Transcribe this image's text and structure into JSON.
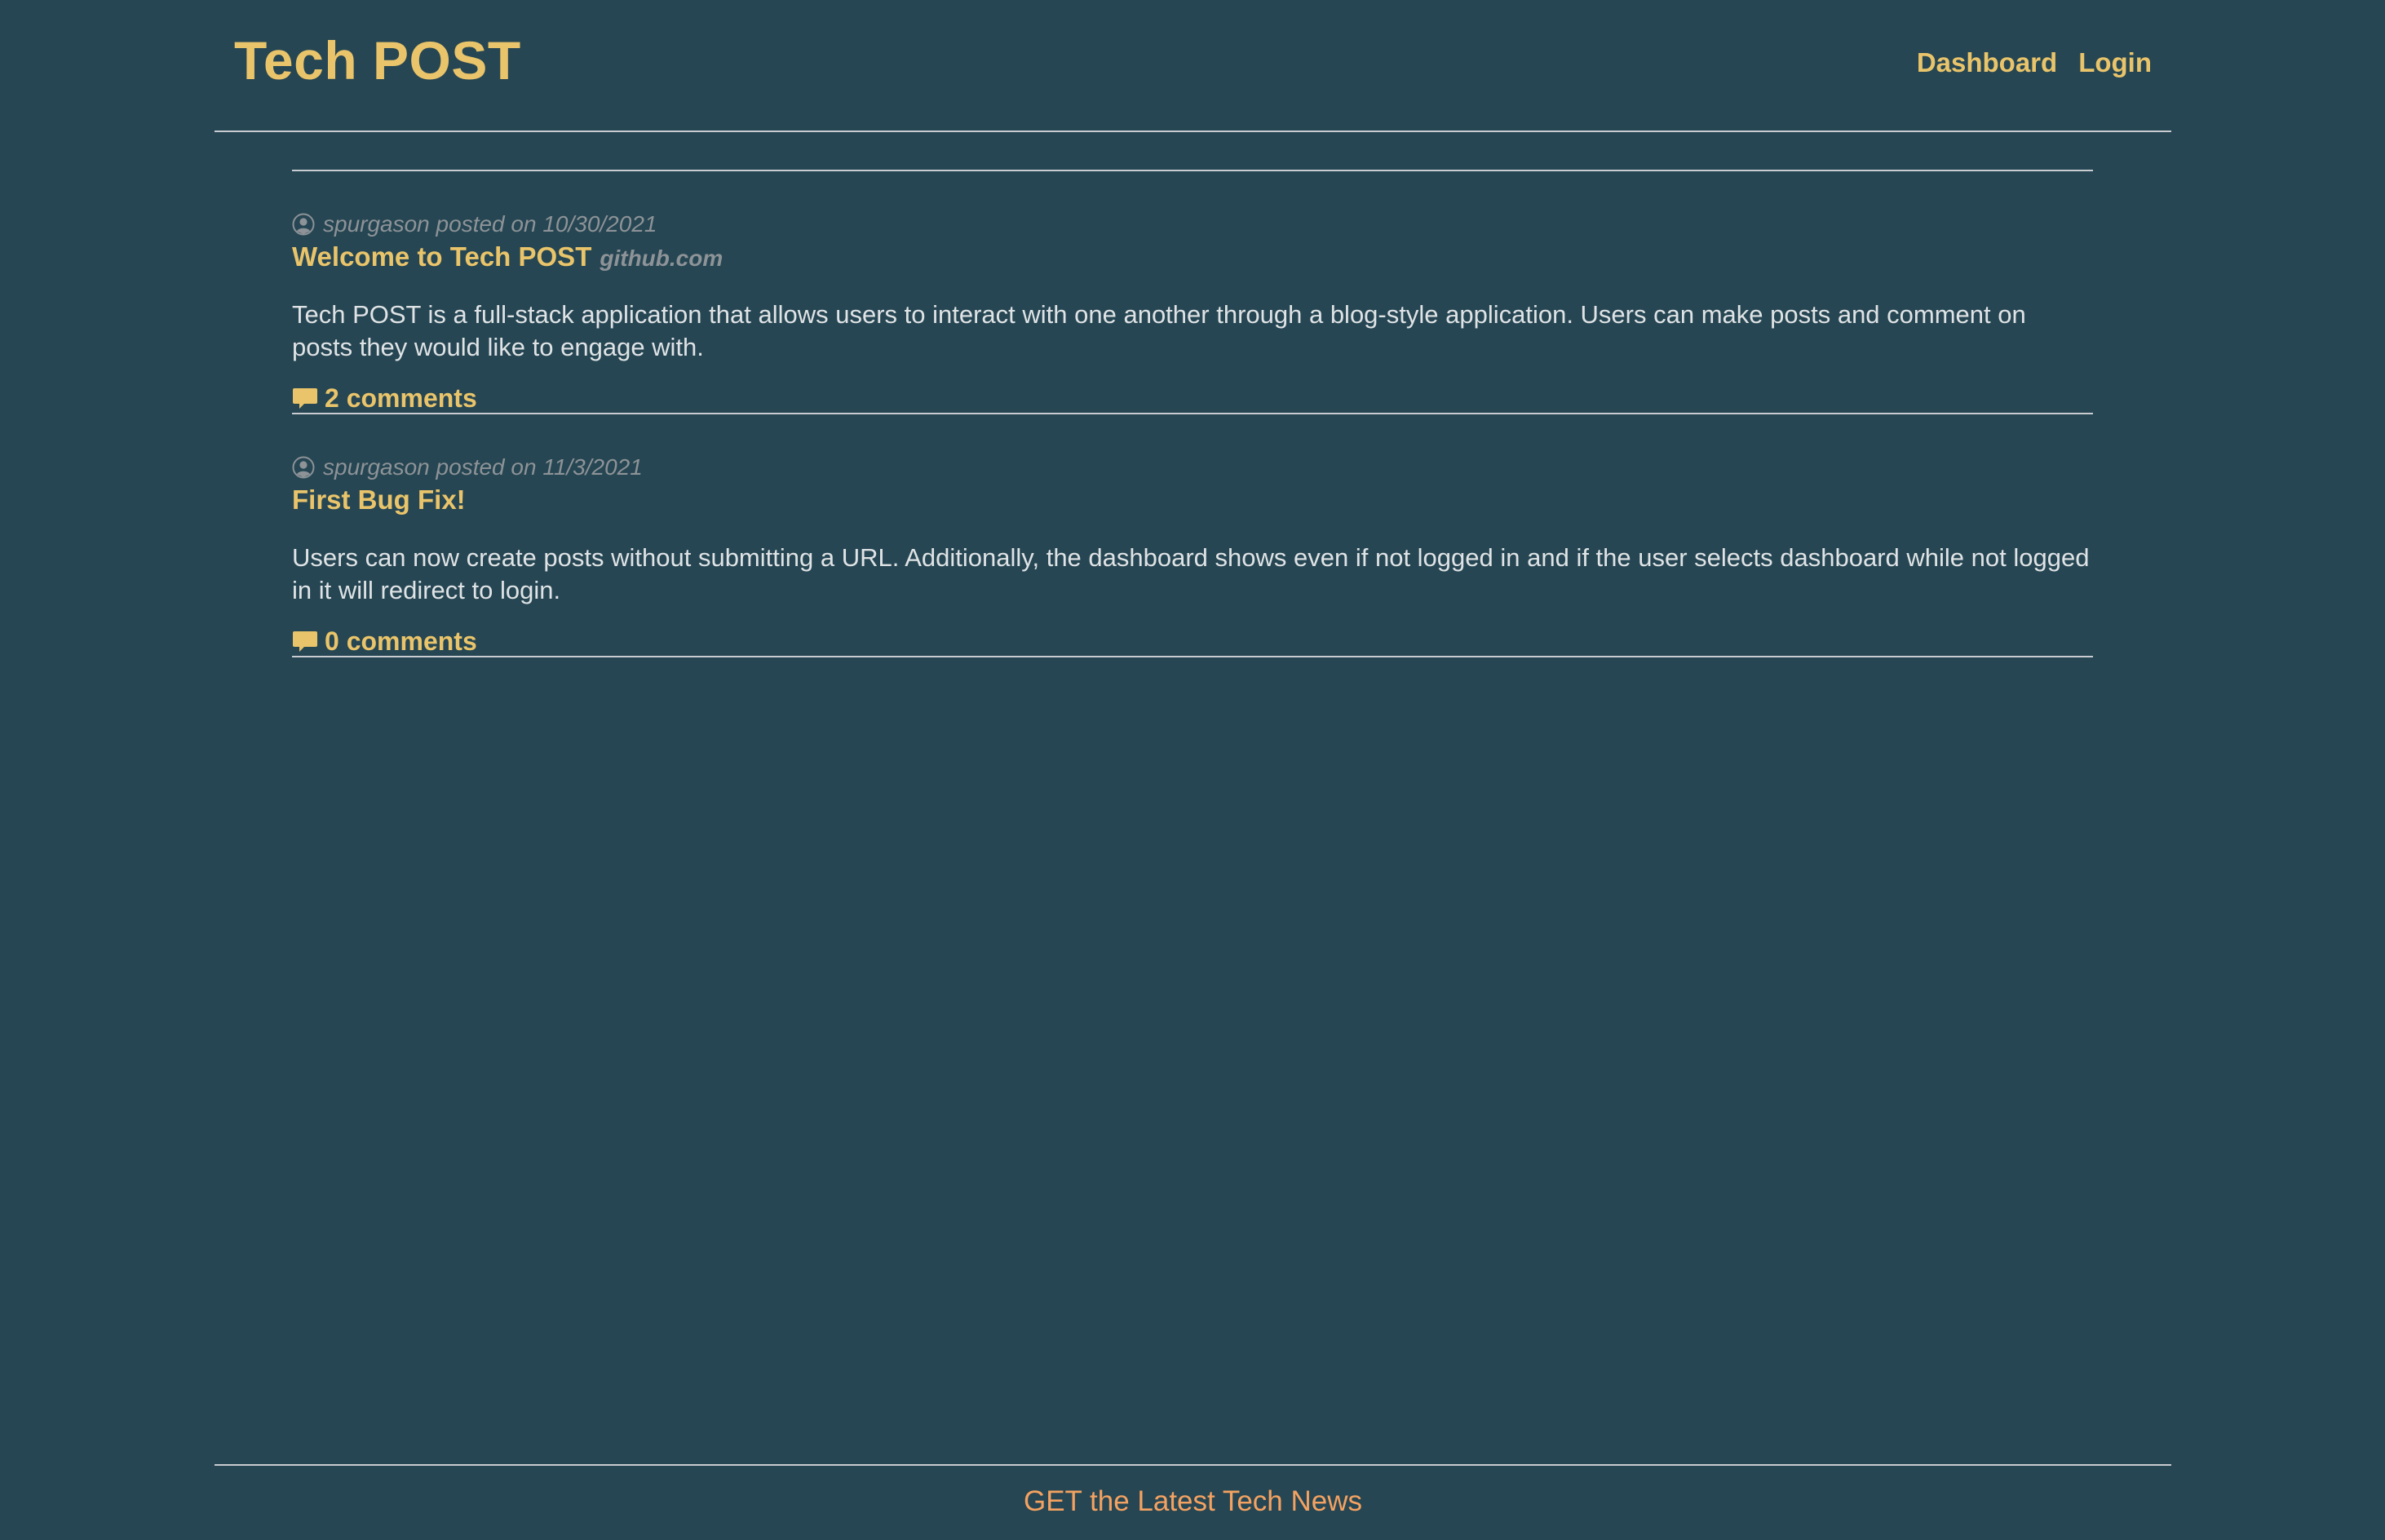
{
  "header": {
    "site_title": "Tech POST",
    "nav": {
      "dashboard": "Dashboard",
      "login": "Login"
    }
  },
  "posts": [
    {
      "author": "spurgason",
      "posted_on_label": "posted on",
      "date": "10/30/2021",
      "title": "Welcome to Tech POST",
      "host": "github.com",
      "body": "Tech POST is a full-stack application that allows users to interact with one another through a blog-style application. Users can make posts and comment on posts they would like to engage with.",
      "comments_label": "2 comments"
    },
    {
      "author": "spurgason",
      "posted_on_label": "posted on",
      "date": "11/3/2021",
      "title": "First Bug Fix!",
      "host": "",
      "body": "Users can now create posts without submitting a URL. Additionally, the dashboard shows even if not logged in and if the user selects dashboard while not logged in it will redirect to login.",
      "comments_label": "0 comments"
    }
  ],
  "footer": {
    "text": "GET the Latest Tech News"
  },
  "colors": {
    "background": "#264653",
    "accent": "#e9c46a",
    "footer_accent": "#f4a261",
    "muted": "#8d9397",
    "body_text": "#dfe3e5",
    "rule": "#c9ccd0"
  },
  "icons": {
    "author": "user-circle-icon",
    "comments": "comment-bubble-icon"
  }
}
